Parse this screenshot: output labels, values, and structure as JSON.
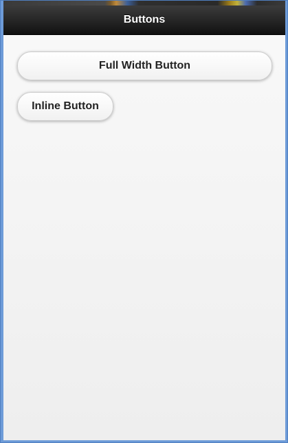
{
  "header": {
    "title": "Buttons"
  },
  "buttons": {
    "full_width_label": "Full Width Button",
    "inline_label": "Inline Button"
  },
  "colors": {
    "header_bg": "#1e1e1e",
    "page_bg": "#f4f4f4",
    "frame": "#6d9bd8"
  }
}
